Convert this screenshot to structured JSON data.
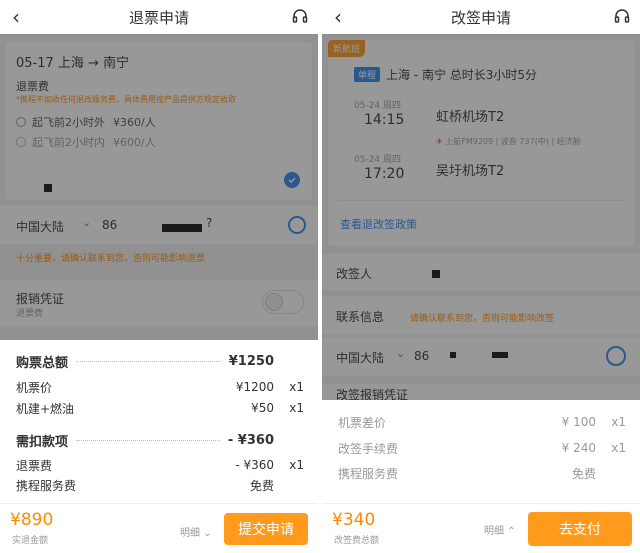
{
  "left": {
    "title": "退票申请",
    "route": "05-17  上海 → 南宁",
    "refund_fee_title": "退票费",
    "refund_notice": "*携程不加收任何退改服务费，具体费用按产品提供方规定收取",
    "rules": [
      {
        "cond": "起飞前2小时外",
        "price": "¥360/人"
      },
      {
        "cond": "起飞前2小时内",
        "price": "¥600/人"
      }
    ],
    "region": "中国大陆",
    "country_code": "86",
    "question": "?",
    "contact_warning": "十分重要，请确认联系到您，否则可能影响退票",
    "voucher_title": "报销凭证",
    "voucher_sub": "退票费",
    "total_label": "购票总额",
    "total_value": "¥1250",
    "items": [
      {
        "label": "机票价",
        "amount": "¥1200",
        "qty": "x1"
      },
      {
        "label": "机建+燃油",
        "amount": "¥50",
        "qty": "x1"
      }
    ],
    "deduct_label": "需扣款项",
    "deduct_value": "- ¥360",
    "deduct_items": [
      {
        "label": "退票费",
        "amount": "- ¥360",
        "qty": "x1"
      },
      {
        "label": "携程服务费",
        "amount": "免费",
        "qty": ""
      }
    ],
    "footer_price": "¥890",
    "footer_price_sub": "实退金额",
    "detail_label": "明细",
    "submit_label": "提交申请"
  },
  "right": {
    "title": "改签申请",
    "badge": "新航班",
    "trip_tag": "单程",
    "trip_summary": "上海 - 南宁  总时长3小时5分",
    "dep_date": "05-24 周四",
    "dep_time": "14:15",
    "dep_airport": "虹桥机场T2",
    "flight_info": "上航FM9209 | 波音 737(中) | 经济舱",
    "arr_date": "05-24 周四",
    "arr_time": "17:20",
    "arr_airport": "吴圩机场T2",
    "policy_link": "查看退改签政策",
    "changer_label": "改签人",
    "contact_label": "联系信息",
    "contact_warning": "请确认联系到您，否则可能影响改签",
    "region": "中国大陆",
    "country_code": "86",
    "partial_row": "改签报销凭证",
    "items": [
      {
        "label": "机票差价",
        "amount": "¥ 100",
        "qty": "x1"
      },
      {
        "label": "改签手续费",
        "amount": "¥ 240",
        "qty": "x1"
      },
      {
        "label": "携程服务费",
        "amount": "免费",
        "qty": ""
      }
    ],
    "footer_price": "¥340",
    "footer_price_sub": "改签费总额",
    "detail_label": "明细",
    "pay_label": "去支付"
  },
  "colors": {
    "accent": "#ff9a1c",
    "link": "#2a86e8",
    "warning": "#ff8a00"
  }
}
